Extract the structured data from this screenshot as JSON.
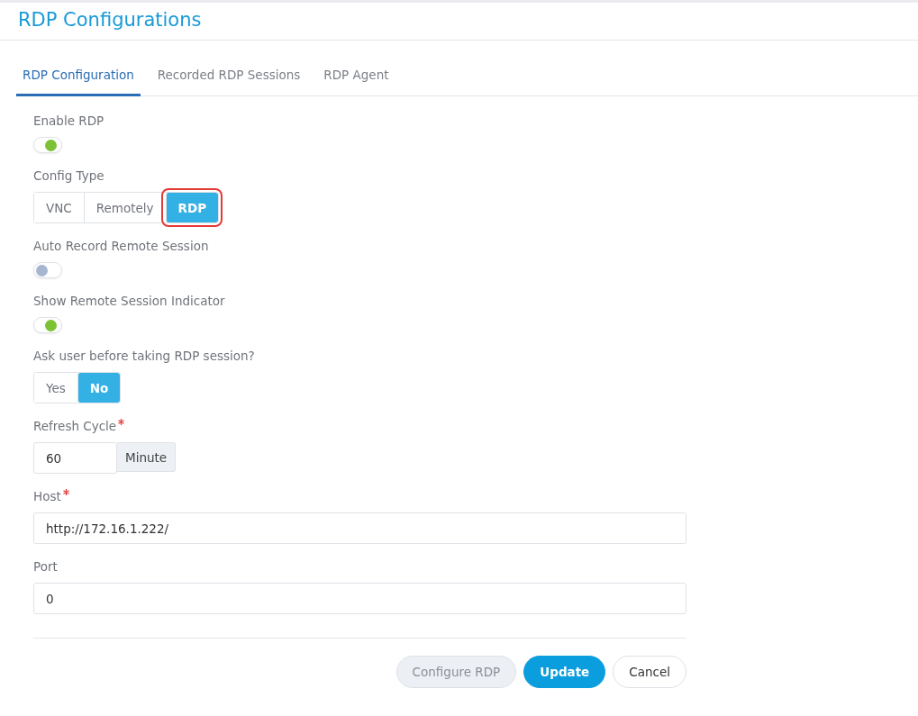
{
  "page": {
    "title": "RDP Configurations"
  },
  "tabs": [
    {
      "label": "RDP Configuration",
      "selected": true
    },
    {
      "label": "Recorded RDP Sessions",
      "selected": false
    },
    {
      "label": "RDP Agent",
      "selected": false
    }
  ],
  "fields": [
    {
      "kind": "toggle",
      "label": "Enable RDP",
      "on": true
    },
    {
      "kind": "segmented",
      "label": "Config Type",
      "options": [
        {
          "label": "VNC",
          "selected": false,
          "highlighted": false
        },
        {
          "label": "Remotely",
          "selected": false,
          "highlighted": false
        },
        {
          "label": "RDP",
          "selected": true,
          "highlighted": true
        }
      ]
    },
    {
      "kind": "toggle",
      "label": "Auto Record Remote Session",
      "on": false
    },
    {
      "kind": "toggle",
      "label": "Show Remote Session Indicator",
      "on": true
    },
    {
      "kind": "segmented",
      "label": "Ask user before taking RDP session?",
      "options": [
        {
          "label": "Yes",
          "selected": false,
          "highlighted": false
        },
        {
          "label": "No",
          "selected": true,
          "highlighted": false
        }
      ]
    },
    {
      "kind": "addon",
      "label": "Refresh Cycle",
      "required": true,
      "value": "60",
      "addon": "Minute"
    },
    {
      "kind": "input",
      "label": "Host",
      "required": true,
      "value": "http://172.16.1.222/"
    },
    {
      "kind": "input",
      "label": "Port",
      "required": false,
      "value": "0"
    }
  ],
  "buttons": [
    {
      "label": "Configure RDP",
      "kind": "secondary",
      "disabled": true
    },
    {
      "label": "Update",
      "kind": "primary",
      "disabled": false
    },
    {
      "label": "Cancel",
      "kind": "outline",
      "disabled": false
    }
  ]
}
